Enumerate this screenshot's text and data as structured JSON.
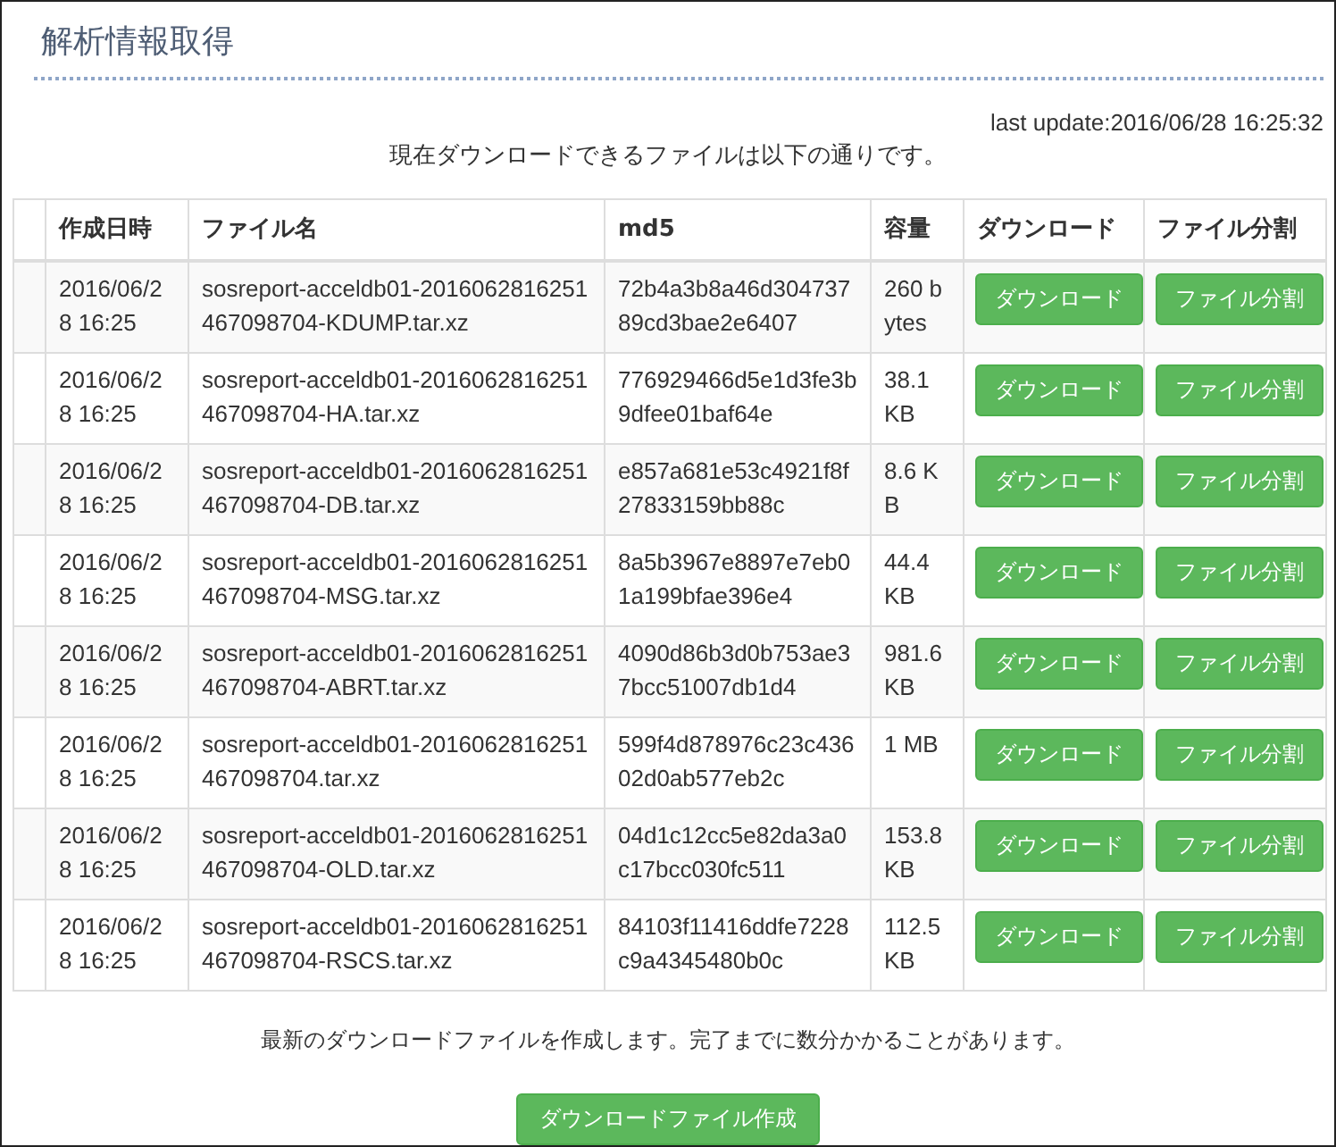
{
  "title": "解析情報取得",
  "last_update": "last update:2016/06/28 16:25:32",
  "intro": "現在ダウンロードできるファイルは以下の通りです。",
  "table": {
    "columns": [
      "作成日時",
      "ファイル名",
      "md5",
      "容量",
      "ダウンロード",
      "ファイル分割"
    ],
    "rows": [
      {
        "created": "2016/06/28 16:25",
        "file": "sosreport-acceldb01-2016062816251467098704-KDUMP.tar.xz",
        "md5": "72b4a3b8a46d30473789cd3bae2e6407",
        "size": "260 bytes",
        "download": "ダウンロード",
        "split": "ファイル分割"
      },
      {
        "created": "2016/06/28 16:25",
        "file": "sosreport-acceldb01-2016062816251467098704-HA.tar.xz",
        "md5": "776929466d5e1d3fe3b9dfee01baf64e",
        "size": "38.1 KB",
        "download": "ダウンロード",
        "split": "ファイル分割"
      },
      {
        "created": "2016/06/28 16:25",
        "file": "sosreport-acceldb01-2016062816251467098704-DB.tar.xz",
        "md5": "e857a681e53c4921f8f27833159bb88c",
        "size": "8.6 KB",
        "download": "ダウンロード",
        "split": "ファイル分割"
      },
      {
        "created": "2016/06/28 16:25",
        "file": "sosreport-acceldb01-2016062816251467098704-MSG.tar.xz",
        "md5": "8a5b3967e8897e7eb01a199bfae396e4",
        "size": "44.4 KB",
        "download": "ダウンロード",
        "split": "ファイル分割"
      },
      {
        "created": "2016/06/28 16:25",
        "file": "sosreport-acceldb01-2016062816251467098704-ABRT.tar.xz",
        "md5": "4090d86b3d0b753ae37bcc51007db1d4",
        "size": "981.6 KB",
        "download": "ダウンロード",
        "split": "ファイル分割"
      },
      {
        "created": "2016/06/28 16:25",
        "file": "sosreport-acceldb01-2016062816251467098704.tar.xz",
        "md5": "599f4d878976c23c43602d0ab577eb2c",
        "size": "1 MB",
        "download": "ダウンロード",
        "split": "ファイル分割"
      },
      {
        "created": "2016/06/28 16:25",
        "file": "sosreport-acceldb01-2016062816251467098704-OLD.tar.xz",
        "md5": "04d1c12cc5e82da3a0c17bcc030fc511",
        "size": "153.8 KB",
        "download": "ダウンロード",
        "split": "ファイル分割"
      },
      {
        "created": "2016/06/28 16:25",
        "file": "sosreport-acceldb01-2016062816251467098704-RSCS.tar.xz",
        "md5": "84103f11416ddfe7228c9a4345480b0c",
        "size": "112.5 KB",
        "download": "ダウンロード",
        "split": "ファイル分割"
      }
    ]
  },
  "note": "最新のダウンロードファイルを作成します。完了までに数分かかることがあります。",
  "create_button": "ダウンロードファイル作成"
}
